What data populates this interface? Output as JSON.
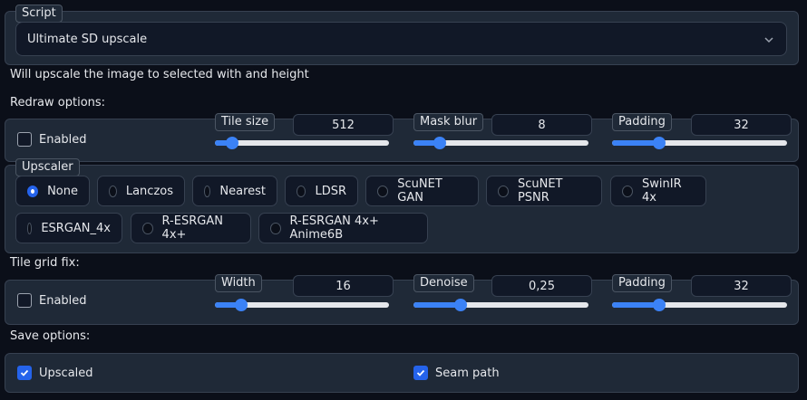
{
  "script": {
    "label": "Script",
    "selected": "Ultimate SD upscale"
  },
  "description": "Will upscale the image to selected with and height",
  "redraw": {
    "heading": "Redraw options:",
    "enabled_label": "Enabled",
    "enabled_checked": false,
    "tile_size": {
      "label": "Tile size",
      "value": "512",
      "slider_fraction": 0.1
    },
    "mask_blur": {
      "label": "Mask blur",
      "value": "8",
      "slider_fraction": 0.15
    },
    "padding": {
      "label": "Padding",
      "value": "32",
      "slider_fraction": 0.27
    }
  },
  "upscaler": {
    "label": "Upscaler",
    "options": [
      "None",
      "Lanczos",
      "Nearest",
      "LDSR",
      "ScuNET GAN",
      "ScuNET PSNR",
      "SwinIR 4x",
      "ESRGAN_4x",
      "R-ESRGAN 4x+",
      "R-ESRGAN 4x+ Anime6B"
    ],
    "selected": "None"
  },
  "seams": {
    "heading": "Tile grid fix:",
    "enabled_label": "Enabled",
    "enabled_checked": false,
    "width": {
      "label": "Width",
      "value": "16",
      "slider_fraction": 0.15
    },
    "denoise": {
      "label": "Denoise",
      "value": "0,25",
      "slider_fraction": 0.27
    },
    "padding": {
      "label": "Padding",
      "value": "32",
      "slider_fraction": 0.27
    }
  },
  "save": {
    "heading": "Save options:",
    "upscaled_label": "Upscaled",
    "upscaled_checked": true,
    "seam_label": "Seam path",
    "seam_checked": true
  }
}
